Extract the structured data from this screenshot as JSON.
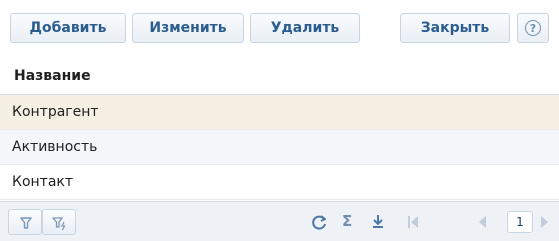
{
  "toolbar": {
    "add_label": "Добавить",
    "edit_label": "Изменить",
    "delete_label": "Удалить",
    "close_label": "Закрыть",
    "help_label": "?"
  },
  "table": {
    "column_header": "Название",
    "rows": [
      "Контрагент",
      "Активность",
      "Контакт"
    ]
  },
  "footer": {
    "page_number": "1"
  },
  "icons": [
    "filter-icon",
    "filter-clear-icon",
    "refresh-icon",
    "sum-icon",
    "export-icon",
    "first-page-icon",
    "prev-page-icon",
    "next-page-icon",
    "help-icon"
  ]
}
